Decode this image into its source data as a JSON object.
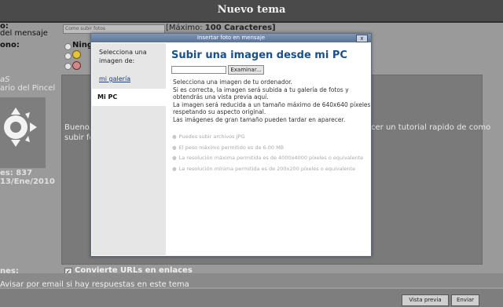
{
  "page": {
    "title": "Nuevo tema"
  },
  "form": {
    "subject_label": "o:",
    "subject_sub": "del mensaje",
    "subject_value": "Como subir fotos",
    "max_prefix": "[Máximo:",
    "max_value": "100 Caracteres]",
    "icon_label": "ono:",
    "icon_option": "Ningu",
    "user_nick": "aS",
    "user_role": "ario del Pincel",
    "editor_text_left": [
      "Bueno, y",
      "subir fot"
    ],
    "editor_text_right": "cer un tutorial rapido de como",
    "stat_posts": "es: 837",
    "stat_date": "13/Ene/2010",
    "options_label": "nes:",
    "convert_urls": "Convierte URLs en enlaces",
    "notify": "Avisar por email si hay respuestas en este tema",
    "preview_button": "Vista previa",
    "send_button": "Enviar"
  },
  "modal": {
    "title": "Insertar foto en mensaje",
    "close": "x",
    "sidebar_heading": "Selecciona una imagen de:",
    "sidebar_link": "mi galería",
    "sidebar_selected": "Mi PC",
    "main_title": "Subir una imagen desde mi PC",
    "browse_button": "Examinar...",
    "description": [
      "Selecciona una imagen de tu ordenador.",
      "Si es correcta, la imagen será subida a tu galería de fotos y",
      "obtendrás una vista previa aquí.",
      "La imagen será reducida a un tamaño máximo de 640x640 píxeles",
      "respetando su aspecto original.",
      "Las imágenes de gran tamaño pueden tardar en aparecer."
    ],
    "rules": [
      "Puedes subir archivos JPG",
      "El peso máximo permitido es de 6.00 MB",
      "La resolución máxima permitida es de 4000x4000 píxeles o equivalente",
      "La resolución mínima permitida es de 200x200 píxeles o equivalente"
    ]
  }
}
